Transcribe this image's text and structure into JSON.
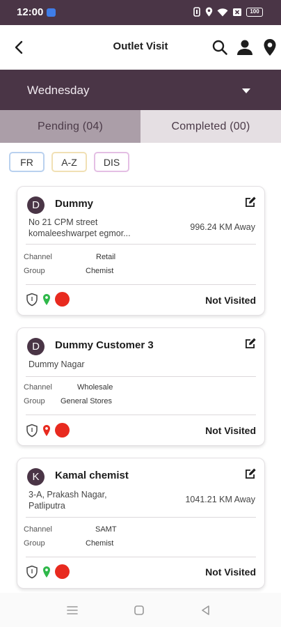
{
  "status_bar": {
    "time": "12:00",
    "battery": "100"
  },
  "header": {
    "title": "Outlet Visit"
  },
  "day_selector": {
    "selected": "Wednesday"
  },
  "tabs": [
    {
      "label": "Pending (04)",
      "active": true
    },
    {
      "label": "Completed (00)",
      "active": false
    }
  ],
  "filters": [
    "FR",
    "A-Z",
    "DIS"
  ],
  "labels": {
    "channel": "Channel",
    "group": "Group"
  },
  "outlets": [
    {
      "initial": "D",
      "name": "Dummy",
      "address_line1": "No 21 CPM street",
      "address_line2": "komaleeshwarpet egmor...",
      "distance": "996.24 KM Away",
      "channel": "Retail",
      "group": "Chemist",
      "location_pin_color": "#2fb84a",
      "status": "Not Visited"
    },
    {
      "initial": "D",
      "name": "Dummy Customer 3",
      "address_line1": "Dummy Nagar",
      "address_line2": "",
      "distance": "",
      "channel": "Wholesale",
      "group": "General Stores",
      "location_pin_color": "#e82a1f",
      "status": "Not Visited"
    },
    {
      "initial": "K",
      "name": "Kamal chemist",
      "address_line1": "3-A, Prakash Nagar,",
      "address_line2": "Patliputra",
      "distance": "1041.21 KM Away",
      "channel": "SAMT",
      "group": "Chemist",
      "location_pin_color": "#2fb84a",
      "status": "Not Visited"
    }
  ],
  "colors": {
    "primary": "#4a3546",
    "pending_tab": "#ab9ea8",
    "completed_tab": "#e5dfe3",
    "status_dot": "#e82a1f"
  }
}
